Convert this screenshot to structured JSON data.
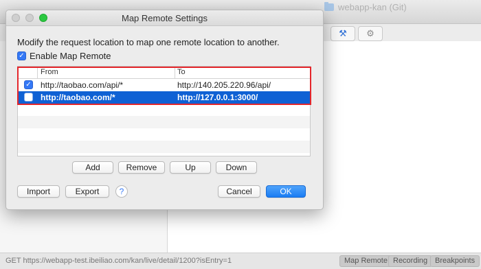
{
  "background": {
    "title": "webapp-kan (Git)",
    "tools": [
      {
        "icon": "tools-icon",
        "glyph": "⚒"
      },
      {
        "icon": "gear-icon",
        "glyph": "⚙"
      }
    ],
    "status_text": "GET https://webapp-test.ibeiliao.com/kan/live/detail/1200?isEntry=1",
    "status_buttons": [
      "Map Remote",
      "Recording",
      "Breakpoints"
    ]
  },
  "dialog": {
    "title": "Map Remote Settings",
    "description": "Modify the request location to map one remote location to another.",
    "enable_label": "Enable Map Remote",
    "enable_checked": true,
    "table": {
      "columns": [
        "From",
        "To"
      ],
      "rows": [
        {
          "enabled": true,
          "from": "http://taobao.com/api/*",
          "to": "http://140.205.220.96/api/",
          "selected": false
        },
        {
          "enabled": false,
          "from": "http://taobao.com/*",
          "to": "http://127.0.0.1:3000/",
          "selected": true
        }
      ]
    },
    "buttons": {
      "add": "Add",
      "remove": "Remove",
      "up": "Up",
      "down": "Down",
      "import": "Import",
      "export": "Export",
      "help": "?",
      "cancel": "Cancel",
      "ok": "OK"
    },
    "colors": {
      "selection": "#0f61d4",
      "highlight_border": "#e4262b",
      "primary_button": "#1a7cf3"
    }
  }
}
